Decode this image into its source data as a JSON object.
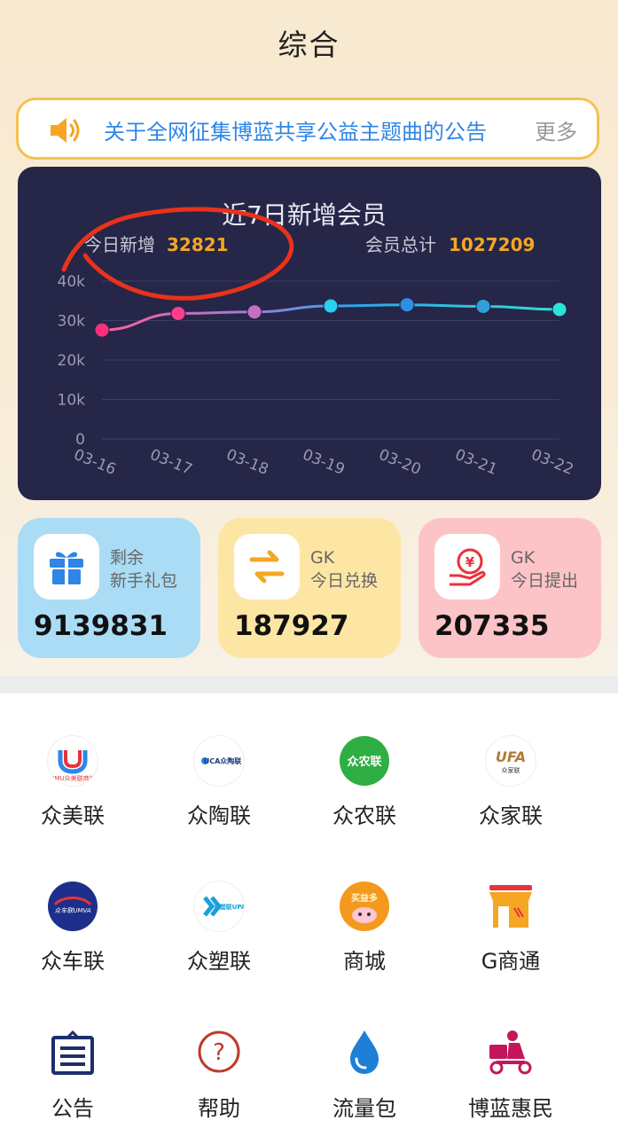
{
  "header": {
    "title": "综合"
  },
  "notice": {
    "text": "关于全网征集博蓝共享公益主题曲的公告",
    "more_label": "更多"
  },
  "chart_panel": {
    "today_label": "今日新增",
    "today_value": "32821",
    "total_label": "会员总计",
    "total_value": "1027209"
  },
  "chart_data": {
    "type": "line",
    "title": "近7日新增会员",
    "categories": [
      "03-16",
      "03-17",
      "03-18",
      "03-19",
      "03-20",
      "03-21",
      "03-22"
    ],
    "values": [
      27600,
      31800,
      32200,
      33700,
      34000,
      33600,
      32821
    ],
    "yticks": [
      "0",
      "10k",
      "20k",
      "30k",
      "40k"
    ],
    "ylim": [
      0,
      40000
    ],
    "grid": true,
    "point_colors": [
      "#ff2f7a",
      "#ff3d8f",
      "#c46fc4",
      "#26d0ef",
      "#2e8fe8",
      "#2f9fdc",
      "#28e4d8"
    ]
  },
  "stats": [
    {
      "label_line1": "剩余",
      "label_line2": "新手礼包",
      "value": "9139831",
      "bg": "#aadcf5",
      "icon": "gift-icon"
    },
    {
      "label_line1": "GK",
      "label_line2": "今日兑换",
      "value": "187927",
      "bg": "#fde6a4",
      "icon": "exchange-icon"
    },
    {
      "label_line1": "GK",
      "label_line2": "今日提出",
      "value": "207335",
      "bg": "#fdc4c8",
      "icon": "withdraw-icon"
    }
  ],
  "menu": [
    {
      "label": "众美联",
      "icon": "zhongmeilian-logo-icon",
      "logo_text": "UMU众美联商城"
    },
    {
      "label": "众陶联",
      "icon": "zhongtaolian-logo-icon",
      "logo_text": "UCA众陶联"
    },
    {
      "label": "众农联",
      "icon": "zhongnonglian-logo-icon",
      "logo_text": "众农联"
    },
    {
      "label": "众家联",
      "icon": "zhongjialian-logo-icon",
      "logo_text": "UFA"
    },
    {
      "label": "众车联",
      "icon": "zhongchelian-logo-icon",
      "logo_text": "众车联UMVA"
    },
    {
      "label": "众塑联",
      "icon": "zhongsulian-logo-icon",
      "logo_text": "众塑联UPA"
    },
    {
      "label": "商城",
      "icon": "mall-icon",
      "logo_text": "买益多"
    },
    {
      "label": "G商通",
      "icon": "storefront-icon"
    },
    {
      "label": "公告",
      "icon": "announcement-icon"
    },
    {
      "label": "帮助",
      "icon": "help-icon"
    },
    {
      "label": "流量包",
      "icon": "data-drop-icon"
    },
    {
      "label": "博蓝惠民",
      "icon": "delivery-scooter-icon"
    }
  ]
}
